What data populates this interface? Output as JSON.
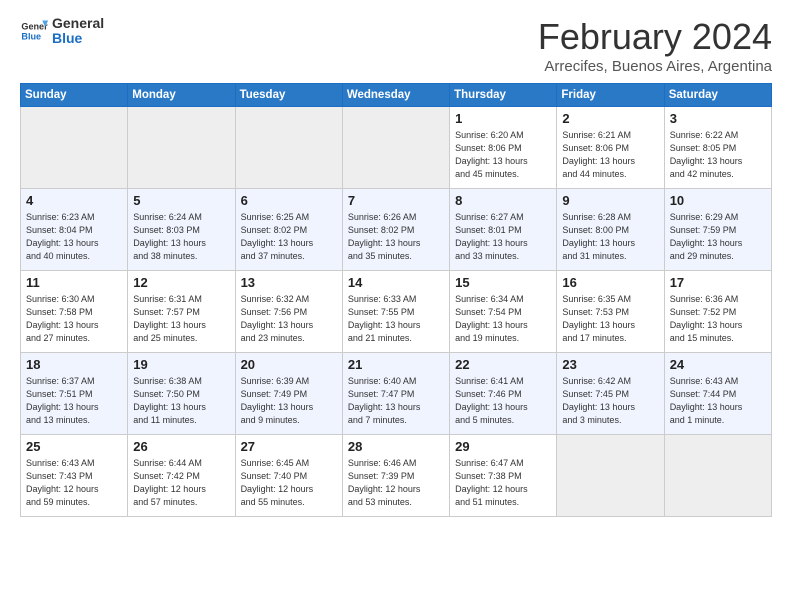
{
  "logo": {
    "line1": "General",
    "line2": "Blue"
  },
  "title": "February 2024",
  "location": "Arrecifes, Buenos Aires, Argentina",
  "days_of_week": [
    "Sunday",
    "Monday",
    "Tuesday",
    "Wednesday",
    "Thursday",
    "Friday",
    "Saturday"
  ],
  "weeks": [
    [
      {
        "day": "",
        "info": ""
      },
      {
        "day": "",
        "info": ""
      },
      {
        "day": "",
        "info": ""
      },
      {
        "day": "",
        "info": ""
      },
      {
        "day": "1",
        "info": "Sunrise: 6:20 AM\nSunset: 8:06 PM\nDaylight: 13 hours\nand 45 minutes."
      },
      {
        "day": "2",
        "info": "Sunrise: 6:21 AM\nSunset: 8:06 PM\nDaylight: 13 hours\nand 44 minutes."
      },
      {
        "day": "3",
        "info": "Sunrise: 6:22 AM\nSunset: 8:05 PM\nDaylight: 13 hours\nand 42 minutes."
      }
    ],
    [
      {
        "day": "4",
        "info": "Sunrise: 6:23 AM\nSunset: 8:04 PM\nDaylight: 13 hours\nand 40 minutes."
      },
      {
        "day": "5",
        "info": "Sunrise: 6:24 AM\nSunset: 8:03 PM\nDaylight: 13 hours\nand 38 minutes."
      },
      {
        "day": "6",
        "info": "Sunrise: 6:25 AM\nSunset: 8:02 PM\nDaylight: 13 hours\nand 37 minutes."
      },
      {
        "day": "7",
        "info": "Sunrise: 6:26 AM\nSunset: 8:02 PM\nDaylight: 13 hours\nand 35 minutes."
      },
      {
        "day": "8",
        "info": "Sunrise: 6:27 AM\nSunset: 8:01 PM\nDaylight: 13 hours\nand 33 minutes."
      },
      {
        "day": "9",
        "info": "Sunrise: 6:28 AM\nSunset: 8:00 PM\nDaylight: 13 hours\nand 31 minutes."
      },
      {
        "day": "10",
        "info": "Sunrise: 6:29 AM\nSunset: 7:59 PM\nDaylight: 13 hours\nand 29 minutes."
      }
    ],
    [
      {
        "day": "11",
        "info": "Sunrise: 6:30 AM\nSunset: 7:58 PM\nDaylight: 13 hours\nand 27 minutes."
      },
      {
        "day": "12",
        "info": "Sunrise: 6:31 AM\nSunset: 7:57 PM\nDaylight: 13 hours\nand 25 minutes."
      },
      {
        "day": "13",
        "info": "Sunrise: 6:32 AM\nSunset: 7:56 PM\nDaylight: 13 hours\nand 23 minutes."
      },
      {
        "day": "14",
        "info": "Sunrise: 6:33 AM\nSunset: 7:55 PM\nDaylight: 13 hours\nand 21 minutes."
      },
      {
        "day": "15",
        "info": "Sunrise: 6:34 AM\nSunset: 7:54 PM\nDaylight: 13 hours\nand 19 minutes."
      },
      {
        "day": "16",
        "info": "Sunrise: 6:35 AM\nSunset: 7:53 PM\nDaylight: 13 hours\nand 17 minutes."
      },
      {
        "day": "17",
        "info": "Sunrise: 6:36 AM\nSunset: 7:52 PM\nDaylight: 13 hours\nand 15 minutes."
      }
    ],
    [
      {
        "day": "18",
        "info": "Sunrise: 6:37 AM\nSunset: 7:51 PM\nDaylight: 13 hours\nand 13 minutes."
      },
      {
        "day": "19",
        "info": "Sunrise: 6:38 AM\nSunset: 7:50 PM\nDaylight: 13 hours\nand 11 minutes."
      },
      {
        "day": "20",
        "info": "Sunrise: 6:39 AM\nSunset: 7:49 PM\nDaylight: 13 hours\nand 9 minutes."
      },
      {
        "day": "21",
        "info": "Sunrise: 6:40 AM\nSunset: 7:47 PM\nDaylight: 13 hours\nand 7 minutes."
      },
      {
        "day": "22",
        "info": "Sunrise: 6:41 AM\nSunset: 7:46 PM\nDaylight: 13 hours\nand 5 minutes."
      },
      {
        "day": "23",
        "info": "Sunrise: 6:42 AM\nSunset: 7:45 PM\nDaylight: 13 hours\nand 3 minutes."
      },
      {
        "day": "24",
        "info": "Sunrise: 6:43 AM\nSunset: 7:44 PM\nDaylight: 13 hours\nand 1 minute."
      }
    ],
    [
      {
        "day": "25",
        "info": "Sunrise: 6:43 AM\nSunset: 7:43 PM\nDaylight: 12 hours\nand 59 minutes."
      },
      {
        "day": "26",
        "info": "Sunrise: 6:44 AM\nSunset: 7:42 PM\nDaylight: 12 hours\nand 57 minutes."
      },
      {
        "day": "27",
        "info": "Sunrise: 6:45 AM\nSunset: 7:40 PM\nDaylight: 12 hours\nand 55 minutes."
      },
      {
        "day": "28",
        "info": "Sunrise: 6:46 AM\nSunset: 7:39 PM\nDaylight: 12 hours\nand 53 minutes."
      },
      {
        "day": "29",
        "info": "Sunrise: 6:47 AM\nSunset: 7:38 PM\nDaylight: 12 hours\nand 51 minutes."
      },
      {
        "day": "",
        "info": ""
      },
      {
        "day": "",
        "info": ""
      }
    ]
  ]
}
